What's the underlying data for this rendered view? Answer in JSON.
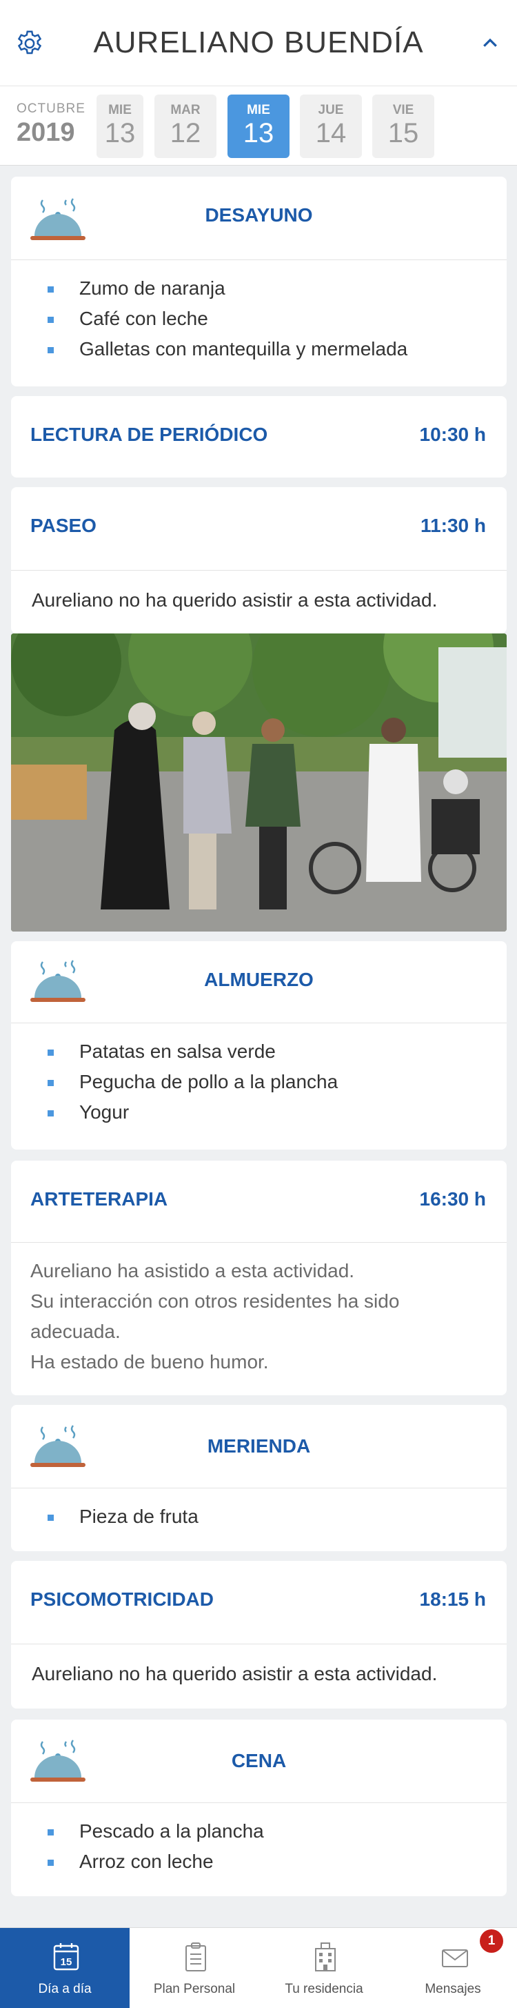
{
  "header": {
    "title": "AURELIANO BUENDÍA"
  },
  "datebar": {
    "month": "OCTUBRE",
    "year": "2019",
    "days": [
      {
        "name": "MIE",
        "num": "13",
        "selected": false
      },
      {
        "name": "MAR",
        "num": "12",
        "selected": false
      },
      {
        "name": "MIE",
        "num": "13",
        "selected": true
      },
      {
        "name": "JUE",
        "num": "14",
        "selected": false
      },
      {
        "name": "VIE",
        "num": "15",
        "selected": false
      }
    ]
  },
  "desayuno": {
    "title": "DESAYUNO",
    "items": [
      "Zumo de naranja",
      "Café con leche",
      "Galletas con mantequilla y mermelada"
    ]
  },
  "lectura": {
    "title": "LECTURA DE PERIÓDICO",
    "time": "10:30 h"
  },
  "paseo": {
    "title": "PASEO",
    "time": "11:30 h",
    "note": "Aureliano no ha querido asistir a esta actividad."
  },
  "almuerzo": {
    "title": "ALMUERZO",
    "items": [
      "Patatas en salsa verde",
      "Pegucha de pollo a la plancha",
      "Yogur"
    ]
  },
  "arteterapia": {
    "title": "ARTETERAPIA",
    "time": "16:30 h",
    "note_lines": [
      "Aureliano ha asistido a esta actividad.",
      "Su interacción con otros residentes ha sido",
      "adecuada.",
      "Ha estado de bueno humor."
    ]
  },
  "merienda": {
    "title": "MERIENDA",
    "items": [
      "Pieza de fruta"
    ]
  },
  "psicomotricidad": {
    "title": "PSICOMOTRICIDAD",
    "time": "18:15 h",
    "note": "Aureliano no ha querido asistir a esta actividad."
  },
  "cena": {
    "title": "CENA",
    "items": [
      "Pescado a la plancha",
      "Arroz con leche"
    ]
  },
  "tabbar": {
    "calendar_day": "15",
    "tabs": [
      {
        "label": "Día a día",
        "icon": "calendar-icon"
      },
      {
        "label": "Plan Personal",
        "icon": "clipboard-icon"
      },
      {
        "label": "Tu residencia",
        "icon": "building-icon"
      },
      {
        "label": "Mensajes",
        "icon": "mail-icon"
      }
    ],
    "badge": "1"
  },
  "colors": {
    "accent": "#1c5aa9",
    "selected_day": "#4b97df",
    "badge": "#c8201b"
  }
}
